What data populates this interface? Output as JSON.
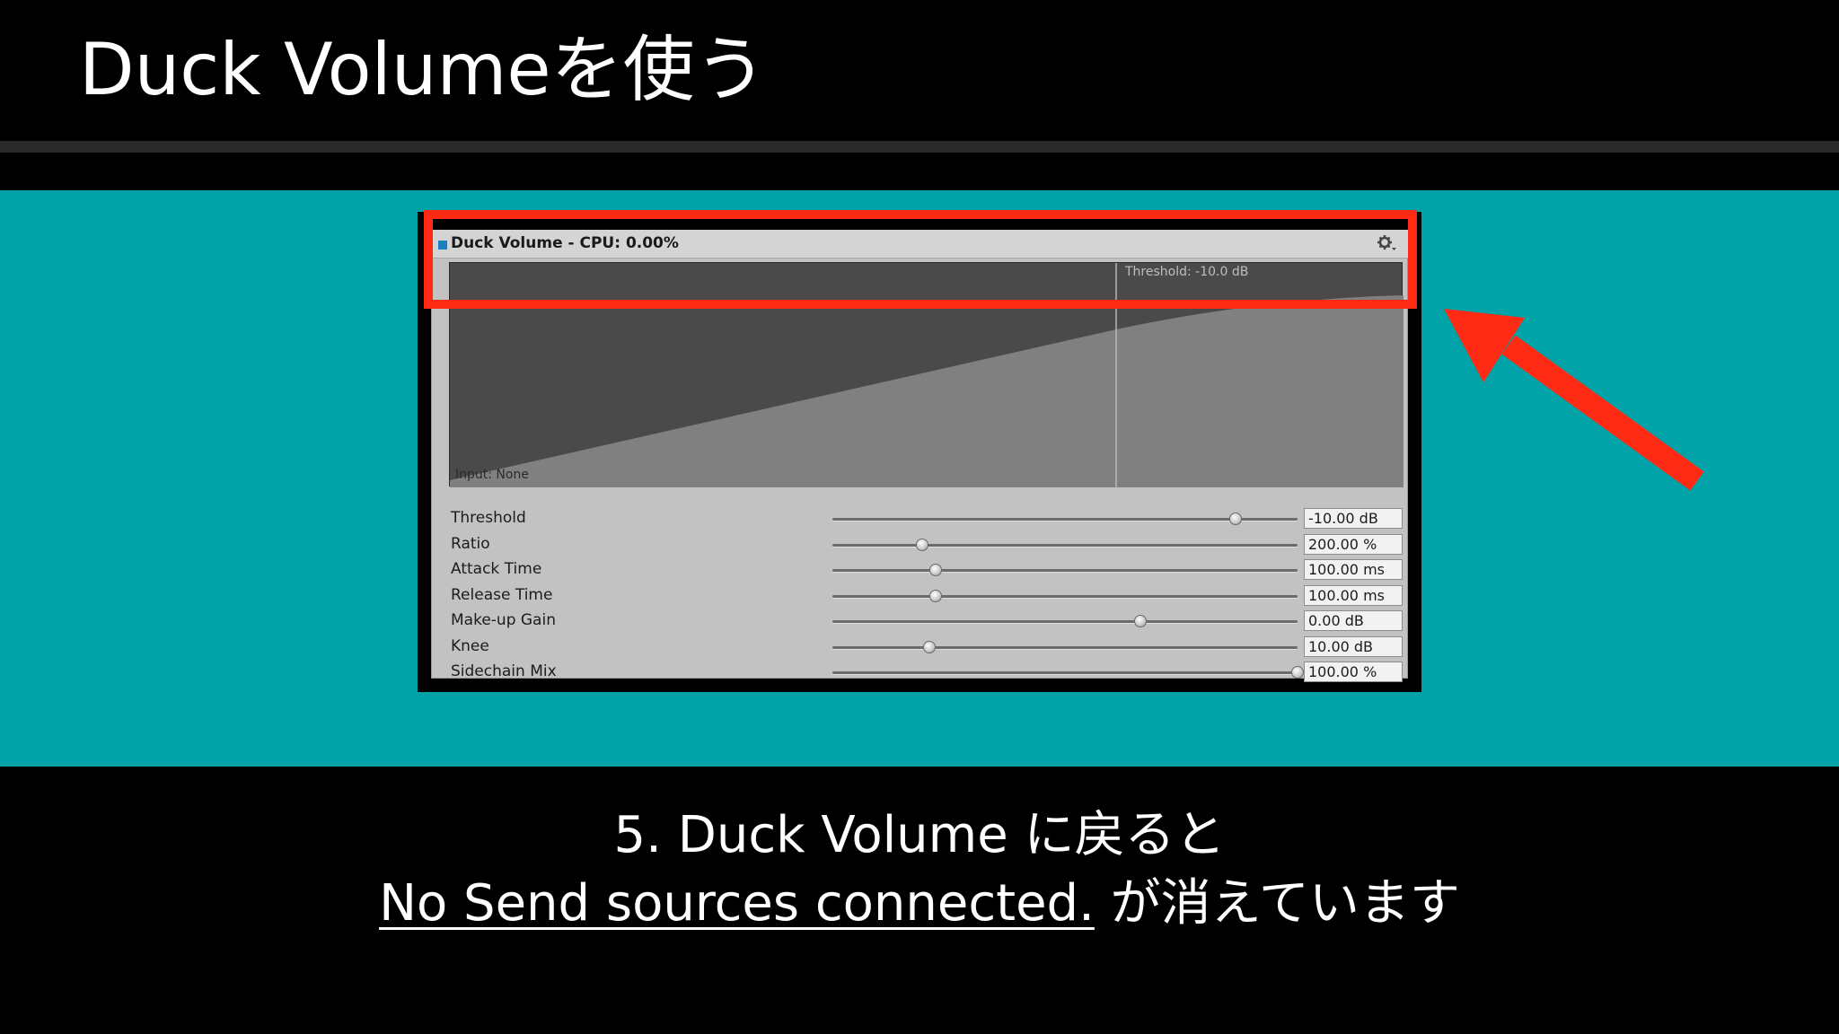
{
  "slide": {
    "title": "Duck Volumeを使う"
  },
  "effect": {
    "header_title": "Duck Volume - CPU: 0.00%",
    "threshold_label": "Threshold: -10.0 dB",
    "input_label": "Input: None",
    "gear_icon": "gear-dropdown-icon",
    "marker_color": "#1b7fc4",
    "params": [
      {
        "label": "Threshold",
        "value": "-10.00 dB",
        "slider_fraction": 0.866
      },
      {
        "label": "Ratio",
        "value": "200.00 %",
        "slider_fraction": 0.193
      },
      {
        "label": "Attack Time",
        "value": "100.00 ms",
        "slider_fraction": 0.222
      },
      {
        "label": "Release Time",
        "value": "100.00 ms",
        "slider_fraction": 0.222
      },
      {
        "label": "Make-up Gain",
        "value": "0.00 dB",
        "slider_fraction": 0.663
      },
      {
        "label": "Knee",
        "value": "10.00 dB",
        "slider_fraction": 0.208
      },
      {
        "label": "Sidechain Mix",
        "value": "100.00 %",
        "slider_fraction": 1.0
      }
    ]
  },
  "caption": {
    "line1": "5. Duck Volume に戻ると",
    "line2_underlined": "No Send sources connected.",
    "line2_rest": " が消えています"
  },
  "colors": {
    "background": "#000000",
    "teal": "#02a3a8",
    "highlight_red": "#ff2a14"
  }
}
